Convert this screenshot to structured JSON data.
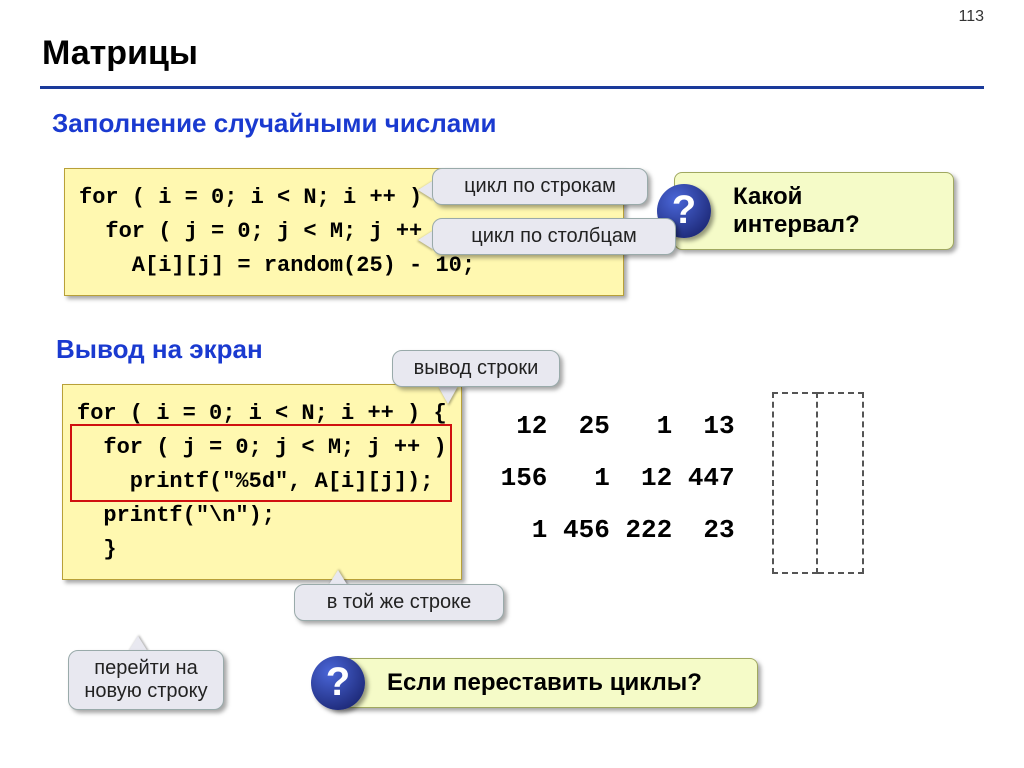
{
  "page_number": "113",
  "title": "Матрицы",
  "subtitle1": "Заполнение случайными числами",
  "subtitle2": "Вывод на экран",
  "code1": "for ( i = 0; i < N; i ++ )\n  for ( j = 0; j < M; j ++ )\n    A[i][j] = random(25) - 10;",
  "code2": "for ( i = 0; i < N; i ++ ) {\n  for ( j = 0; j < M; j ++ )\n    printf(\"%5d\", A[i][j]);\n  printf(\"\\n\");\n  }",
  "callouts": {
    "rows_loop": "цикл по строкам",
    "cols_loop": "цикл по столбцам",
    "row_output": "вывод строки",
    "same_line": "в той же строке",
    "newline": "перейти на\nновую строку"
  },
  "questions": {
    "interval": "Какой интервал?",
    "swap_loops": "Если переставить циклы?"
  },
  "qmark": "?",
  "matrix_text": "  12  25   1  13\n 156   1  12 447\n   1 456 222  23"
}
